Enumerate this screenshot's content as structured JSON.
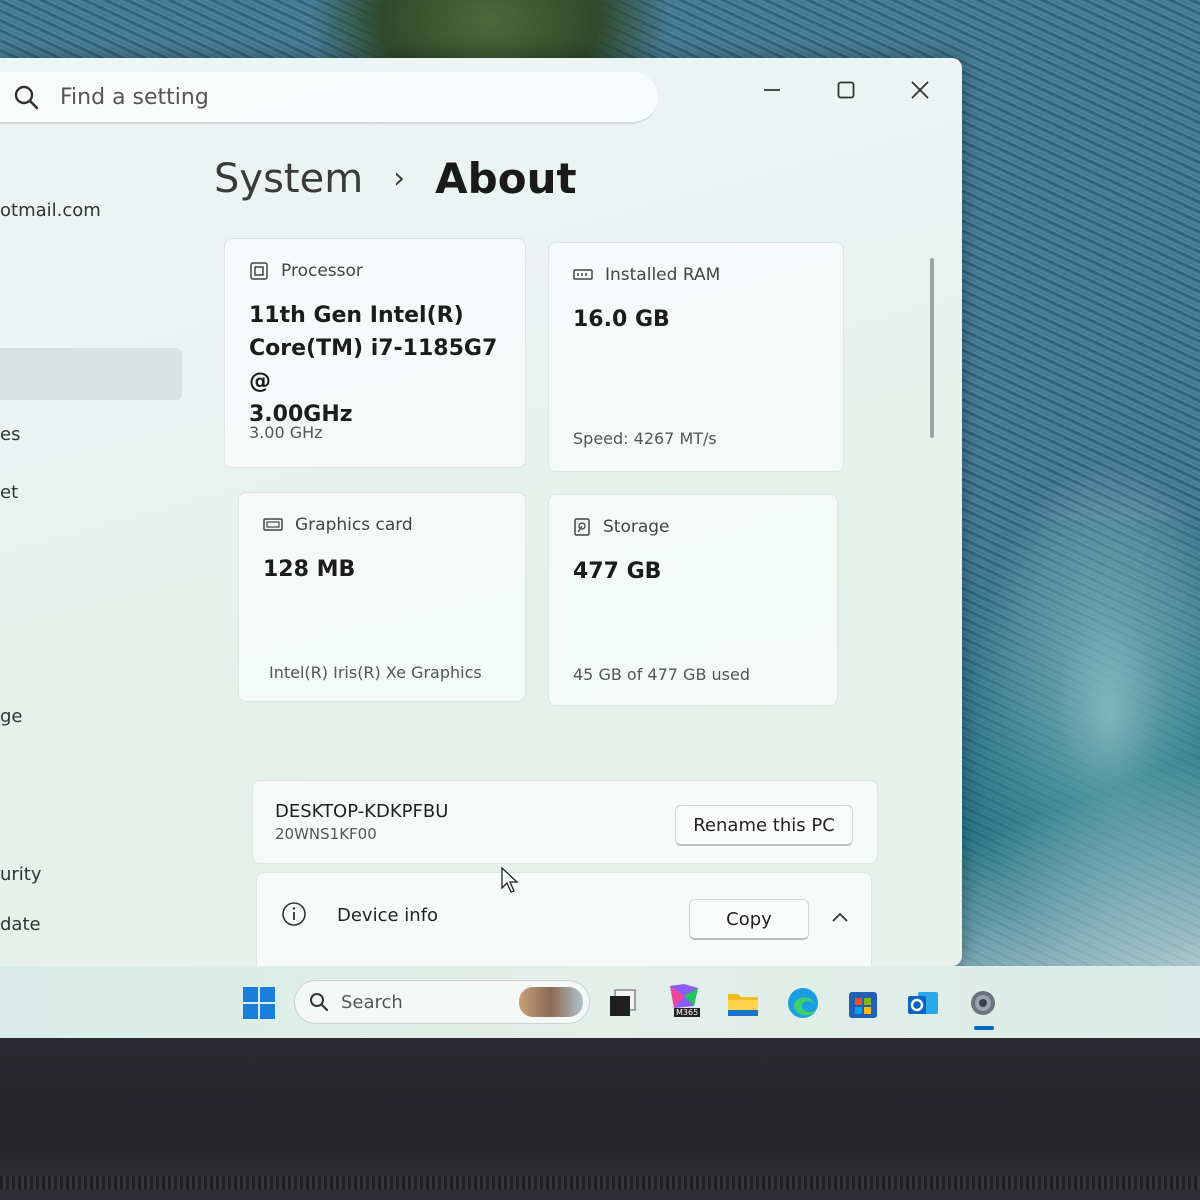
{
  "search": {
    "placeholder": "Find a setting"
  },
  "sidebar": {
    "items": [
      {
        "label": "otmail.com"
      },
      {
        "label": "es"
      },
      {
        "label": "et"
      },
      {
        "label": "ge"
      },
      {
        "label": "urity"
      },
      {
        "label": "date"
      }
    ]
  },
  "breadcrumb": {
    "parent": "System",
    "separator": "›",
    "current": "About"
  },
  "specs": {
    "processor": {
      "label": "Processor",
      "line1": "11th Gen Intel(R)",
      "line2": "Core(TM) i7-1185G7 @",
      "line3": "3.00GHz",
      "sub": "3.00 GHz"
    },
    "ram": {
      "label": "Installed RAM",
      "value": "16.0 GB",
      "sub": "Speed: 4267 MT/s"
    },
    "graphics": {
      "label": "Graphics card",
      "value": "128 MB",
      "sub": "Intel(R) Iris(R) Xe Graphics"
    },
    "storage": {
      "label": "Storage",
      "value": "477 GB",
      "sub": "45 GB of 477 GB used"
    }
  },
  "device": {
    "name": "DESKTOP-KDKPFBU",
    "model": "20WNS1KF00",
    "rename_label": "Rename this PC"
  },
  "device_info": {
    "label": "Device info",
    "copy_label": "Copy"
  },
  "taskbar": {
    "search_label": "Search",
    "m365_label": "M365"
  },
  "colors": {
    "accent": "#0067c0",
    "window_bg": "#eaf3f1",
    "taskbar_bg": "#dcebe7"
  }
}
